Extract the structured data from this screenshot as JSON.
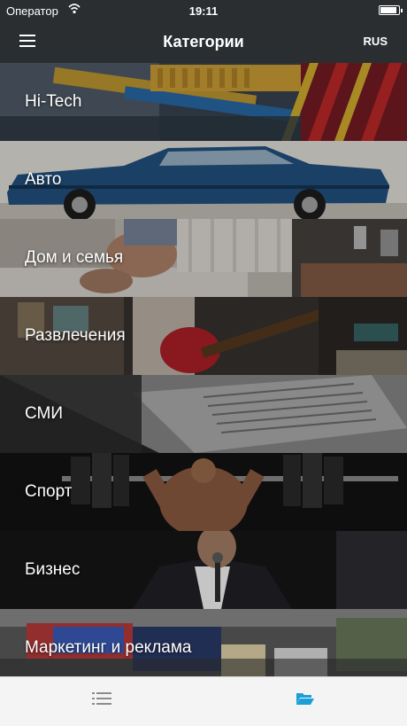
{
  "status_bar": {
    "carrier": "Оператор",
    "time": "19:11",
    "battery_level": 0.9
  },
  "nav": {
    "title": "Категории",
    "lang": "RUS"
  },
  "categories": [
    {
      "label": "Hi-Tech"
    },
    {
      "label": "Авто"
    },
    {
      "label": "Дом и семья"
    },
    {
      "label": "Развлечения"
    },
    {
      "label": "СМИ"
    },
    {
      "label": "Спорт"
    },
    {
      "label": "Бизнес"
    },
    {
      "label": "Маркетинг и реклама"
    }
  ],
  "tabs": [
    {
      "icon": "list-icon",
      "active": false
    },
    {
      "icon": "folder-open-icon",
      "active": true
    }
  ],
  "colors": {
    "bar_bg": "#2b2e31",
    "tab_active": "#1a9fd6",
    "tab_inactive": "#8c8c8c"
  }
}
